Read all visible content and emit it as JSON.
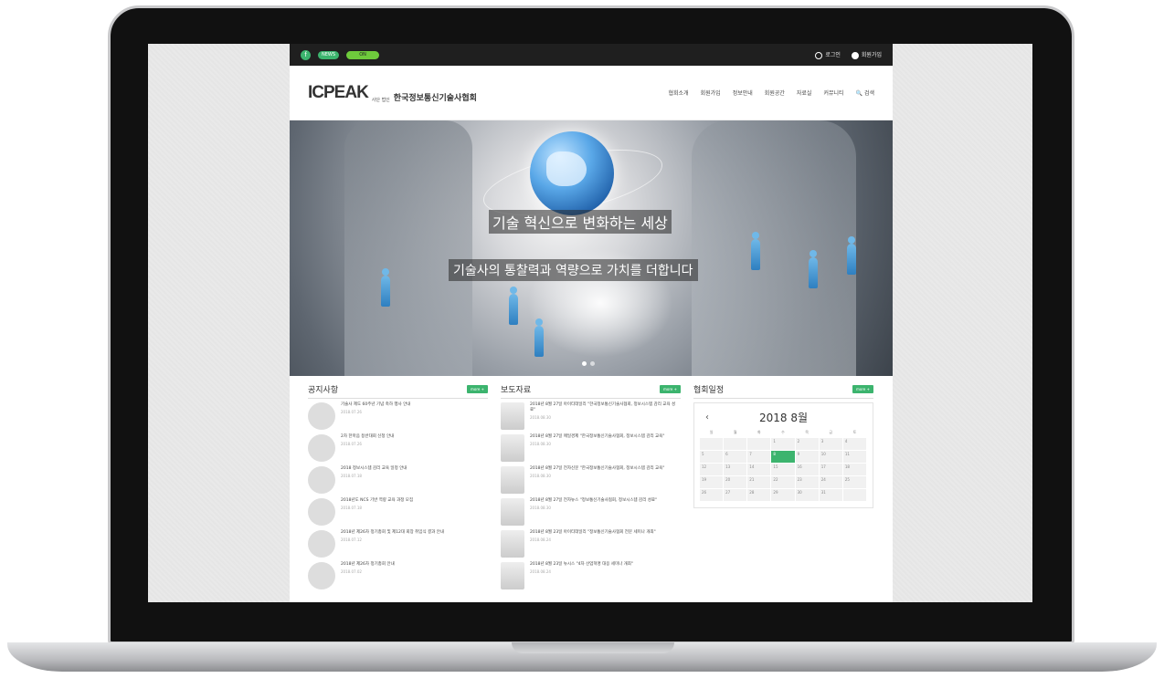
{
  "topbar": {
    "facebook_icon": "f",
    "pill_label": "NEWS",
    "pill2_label": "ON",
    "login": "로그인",
    "join": "회원가입"
  },
  "header": {
    "logo_text": "ICPEAK",
    "logo_sub": "사단 법인",
    "org_name": "한국정보통신기술사협회",
    "nav": [
      "협회소개",
      "회원가입",
      "정보안내",
      "회원공간",
      "자료실",
      "커뮤니티",
      "검색"
    ]
  },
  "hero": {
    "title": "기술 혁신으로 변화하는 세상",
    "subtitle": "기술사의 통찰력과 역량으로 가치를 더합니다"
  },
  "notice": {
    "title": "공지사항",
    "more": "more +",
    "items": [
      {
        "text": "기술사 제도 60주년 기념 축하 행사 안내",
        "date": "2018.07.26"
      },
      {
        "text": "2차 한마음 등반대회 신청 안내",
        "date": "2018.07.26"
      },
      {
        "text": "2018 정보시스템 감리 교육 일정 안내",
        "date": "2018.07.18"
      },
      {
        "text": "2018년도 NCS 기반 역량 교육 과정 모집",
        "date": "2018.07.18"
      },
      {
        "text": "2018년 제26차 정기총회 및 제12대 회장 취임식 결과 안내",
        "date": "2018.07.12"
      },
      {
        "text": "2018년 제26차 정기총회 안내",
        "date": "2018.07.02"
      }
    ]
  },
  "press": {
    "title": "보도자료",
    "more": "more +",
    "items": [
      {
        "text": "2018년 8월 27일 아이티데일리 \"한국정보통신기술사협회, 정보시스템 감리 교육 성료\"",
        "date": "2018.08.30"
      },
      {
        "text": "2018년 8월 27일 매일경제 \"한국정보통신기술사협회, 정보시스템 감리 교육\"",
        "date": "2018.08.30"
      },
      {
        "text": "2018년 8월 27일 전자신문 \"한국정보통신기술사협회, 정보시스템 감리 교육\"",
        "date": "2018.08.30"
      },
      {
        "text": "2018년 8월 27일 전자뉴스 \"정보통신기술사협회, 정보시스템 감리 성료\"",
        "date": "2018.08.30"
      },
      {
        "text": "2018년 8월 23일 아이티데일리 \"정보통신기술사협회 전문 세미나 개최\"",
        "date": "2018.08.24"
      },
      {
        "text": "2018년 8월 23일 뉴시스 \"4차 산업혁명 대응 세미나 개최\"",
        "date": "2018.08.24"
      }
    ]
  },
  "schedule": {
    "title": "협회일정",
    "more": "more +",
    "month_label": "2018 8월",
    "prev": "‹",
    "dow": [
      "일",
      "월",
      "화",
      "수",
      "목",
      "금",
      "토"
    ],
    "days": [
      "",
      "",
      "",
      "1",
      "2",
      "3",
      "4",
      "5",
      "6",
      "7",
      "8",
      "9",
      "10",
      "11",
      "12",
      "13",
      "14",
      "15",
      "16",
      "17",
      "18",
      "19",
      "20",
      "21",
      "22",
      "23",
      "24",
      "25",
      "26",
      "27",
      "28",
      "29",
      "30",
      "31",
      ""
    ],
    "today": "8"
  },
  "colors": {
    "accent": "#3cb46e",
    "topbar": "#1f1f1f"
  }
}
